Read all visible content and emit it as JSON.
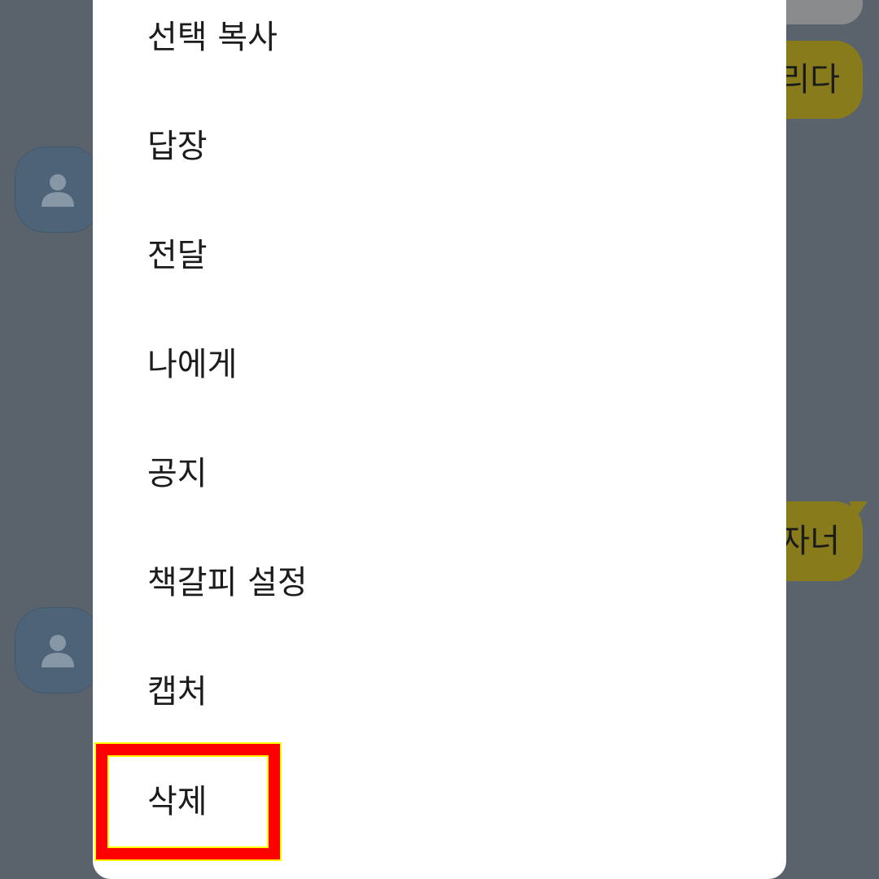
{
  "chat": {
    "bubble_1_text": "리다",
    "bubble_2_text": "자너"
  },
  "menu": {
    "items": [
      {
        "label": "선택 복사"
      },
      {
        "label": "답장"
      },
      {
        "label": "전달"
      },
      {
        "label": "나에게"
      },
      {
        "label": "공지"
      },
      {
        "label": "책갈피 설정"
      },
      {
        "label": "캡처"
      },
      {
        "label": "삭제"
      }
    ],
    "highlighted_item": "삭제"
  },
  "colors": {
    "background_dim": "#5a636b",
    "my_bubble": "#877b1c",
    "avatar": "#4d6378",
    "menu_bg": "#ffffff",
    "highlight_border": "#ff0000",
    "highlight_outline": "#ffff00"
  },
  "icons": {
    "avatar": "person-icon"
  }
}
